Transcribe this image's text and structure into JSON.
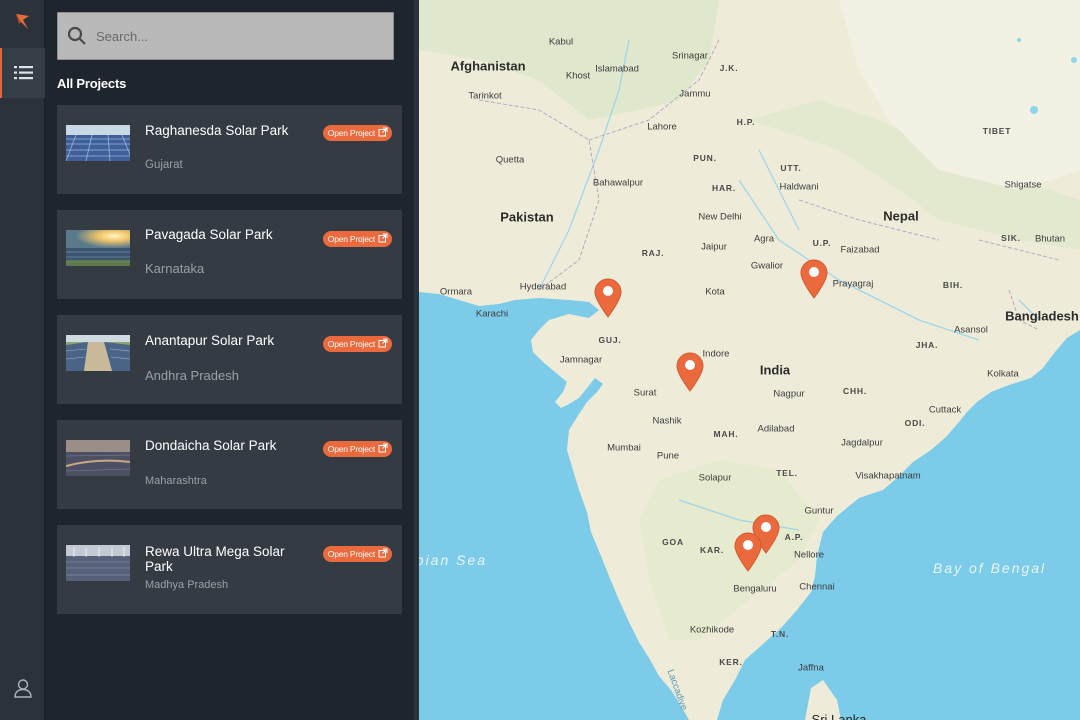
{
  "search": {
    "placeholder": "Search..."
  },
  "section_title": "All Projects",
  "open_label": "Open Project",
  "projects": [
    {
      "name": "Raghanesda Solar Park",
      "state": "Gujarat"
    },
    {
      "name": "Pavagada Solar Park",
      "state": "Karnataka"
    },
    {
      "name": "Anantapur Solar Park",
      "state": "Andhra Pradesh"
    },
    {
      "name": "Dondaicha Solar Park",
      "state": "Maharashtra"
    },
    {
      "name": "Rewa Ultra Mega Solar Park",
      "state": "Madhya Pradesh"
    }
  ],
  "map": {
    "countries": [
      "Afghanistan",
      "Pakistan",
      "Nepal",
      "India",
      "Bangladesh",
      "Bhutan",
      "Sri Lanka",
      "TIBET"
    ],
    "cities": [
      "Kabul",
      "Islamabad",
      "Khost",
      "Srinagar",
      "J.K.",
      "Tarinkot",
      "Jammu",
      "Lahore",
      "H.P.",
      "Quetta",
      "PUN.",
      "UTT.",
      "Haldwani",
      "Bahawalpur",
      "HAR.",
      "New Delhi",
      "Shigatse",
      "SIK.",
      "RAJ.",
      "Jaipur",
      "Agra",
      "U.P.",
      "Faizabad",
      "Gwalior",
      "Prayagraj",
      "Hyderabad",
      "Kota",
      "BIH.",
      "Ormara",
      "Karachi",
      "GUJ.",
      "Asansol",
      "Jamnagar",
      "Indore",
      "JHA.",
      "Kolkata",
      "Surat",
      "Nagpur",
      "CHH.",
      "Nashik",
      "Cuttack",
      "MAH.",
      "Adilabad",
      "ODI.",
      "Mumbai",
      "Jagdalpur",
      "Pune",
      "TEL.",
      "Visakhapatnam",
      "Solapur",
      "Guntur",
      "A.P.",
      "GOA",
      "KAR.",
      "Nellore",
      "Chennai",
      "Bengaluru",
      "Kozhikode",
      "T.N.",
      "KER.",
      "Jaffna",
      "Laccadive"
    ],
    "seas": [
      "Arabian Sea",
      "Bay of Bengal"
    ]
  },
  "colors": {
    "accent": "#ea6a3d",
    "water": "#7ccbe8",
    "land": "#eeecd9"
  }
}
